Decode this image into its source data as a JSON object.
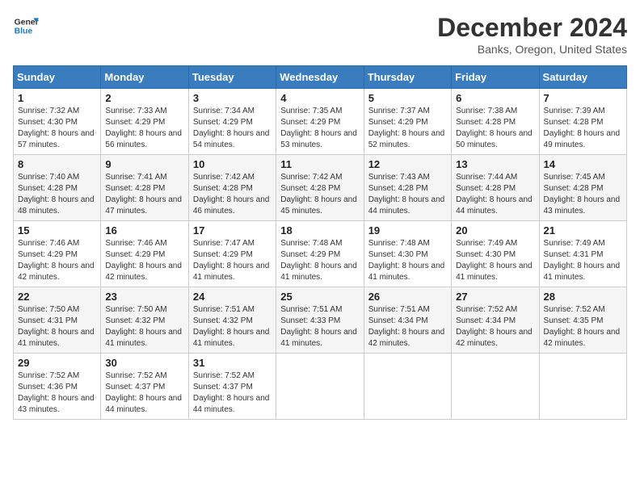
{
  "logo": {
    "line1": "General",
    "line2": "Blue"
  },
  "title": "December 2024",
  "location": "Banks, Oregon, United States",
  "weekdays": [
    "Sunday",
    "Monday",
    "Tuesday",
    "Wednesday",
    "Thursday",
    "Friday",
    "Saturday"
  ],
  "weeks": [
    [
      {
        "day": "1",
        "sunrise": "7:32 AM",
        "sunset": "4:30 PM",
        "daylight": "8 hours and 57 minutes."
      },
      {
        "day": "2",
        "sunrise": "7:33 AM",
        "sunset": "4:29 PM",
        "daylight": "8 hours and 56 minutes."
      },
      {
        "day": "3",
        "sunrise": "7:34 AM",
        "sunset": "4:29 PM",
        "daylight": "8 hours and 54 minutes."
      },
      {
        "day": "4",
        "sunrise": "7:35 AM",
        "sunset": "4:29 PM",
        "daylight": "8 hours and 53 minutes."
      },
      {
        "day": "5",
        "sunrise": "7:37 AM",
        "sunset": "4:29 PM",
        "daylight": "8 hours and 52 minutes."
      },
      {
        "day": "6",
        "sunrise": "7:38 AM",
        "sunset": "4:28 PM",
        "daylight": "8 hours and 50 minutes."
      },
      {
        "day": "7",
        "sunrise": "7:39 AM",
        "sunset": "4:28 PM",
        "daylight": "8 hours and 49 minutes."
      }
    ],
    [
      {
        "day": "8",
        "sunrise": "7:40 AM",
        "sunset": "4:28 PM",
        "daylight": "8 hours and 48 minutes."
      },
      {
        "day": "9",
        "sunrise": "7:41 AM",
        "sunset": "4:28 PM",
        "daylight": "8 hours and 47 minutes."
      },
      {
        "day": "10",
        "sunrise": "7:42 AM",
        "sunset": "4:28 PM",
        "daylight": "8 hours and 46 minutes."
      },
      {
        "day": "11",
        "sunrise": "7:42 AM",
        "sunset": "4:28 PM",
        "daylight": "8 hours and 45 minutes."
      },
      {
        "day": "12",
        "sunrise": "7:43 AM",
        "sunset": "4:28 PM",
        "daylight": "8 hours and 44 minutes."
      },
      {
        "day": "13",
        "sunrise": "7:44 AM",
        "sunset": "4:28 PM",
        "daylight": "8 hours and 44 minutes."
      },
      {
        "day": "14",
        "sunrise": "7:45 AM",
        "sunset": "4:28 PM",
        "daylight": "8 hours and 43 minutes."
      }
    ],
    [
      {
        "day": "15",
        "sunrise": "7:46 AM",
        "sunset": "4:29 PM",
        "daylight": "8 hours and 42 minutes."
      },
      {
        "day": "16",
        "sunrise": "7:46 AM",
        "sunset": "4:29 PM",
        "daylight": "8 hours and 42 minutes."
      },
      {
        "day": "17",
        "sunrise": "7:47 AM",
        "sunset": "4:29 PM",
        "daylight": "8 hours and 41 minutes."
      },
      {
        "day": "18",
        "sunrise": "7:48 AM",
        "sunset": "4:29 PM",
        "daylight": "8 hours and 41 minutes."
      },
      {
        "day": "19",
        "sunrise": "7:48 AM",
        "sunset": "4:30 PM",
        "daylight": "8 hours and 41 minutes."
      },
      {
        "day": "20",
        "sunrise": "7:49 AM",
        "sunset": "4:30 PM",
        "daylight": "8 hours and 41 minutes."
      },
      {
        "day": "21",
        "sunrise": "7:49 AM",
        "sunset": "4:31 PM",
        "daylight": "8 hours and 41 minutes."
      }
    ],
    [
      {
        "day": "22",
        "sunrise": "7:50 AM",
        "sunset": "4:31 PM",
        "daylight": "8 hours and 41 minutes."
      },
      {
        "day": "23",
        "sunrise": "7:50 AM",
        "sunset": "4:32 PM",
        "daylight": "8 hours and 41 minutes."
      },
      {
        "day": "24",
        "sunrise": "7:51 AM",
        "sunset": "4:32 PM",
        "daylight": "8 hours and 41 minutes."
      },
      {
        "day": "25",
        "sunrise": "7:51 AM",
        "sunset": "4:33 PM",
        "daylight": "8 hours and 41 minutes."
      },
      {
        "day": "26",
        "sunrise": "7:51 AM",
        "sunset": "4:34 PM",
        "daylight": "8 hours and 42 minutes."
      },
      {
        "day": "27",
        "sunrise": "7:52 AM",
        "sunset": "4:34 PM",
        "daylight": "8 hours and 42 minutes."
      },
      {
        "day": "28",
        "sunrise": "7:52 AM",
        "sunset": "4:35 PM",
        "daylight": "8 hours and 42 minutes."
      }
    ],
    [
      {
        "day": "29",
        "sunrise": "7:52 AM",
        "sunset": "4:36 PM",
        "daylight": "8 hours and 43 minutes."
      },
      {
        "day": "30",
        "sunrise": "7:52 AM",
        "sunset": "4:37 PM",
        "daylight": "8 hours and 44 minutes."
      },
      {
        "day": "31",
        "sunrise": "7:52 AM",
        "sunset": "4:37 PM",
        "daylight": "8 hours and 44 minutes."
      },
      null,
      null,
      null,
      null
    ]
  ]
}
